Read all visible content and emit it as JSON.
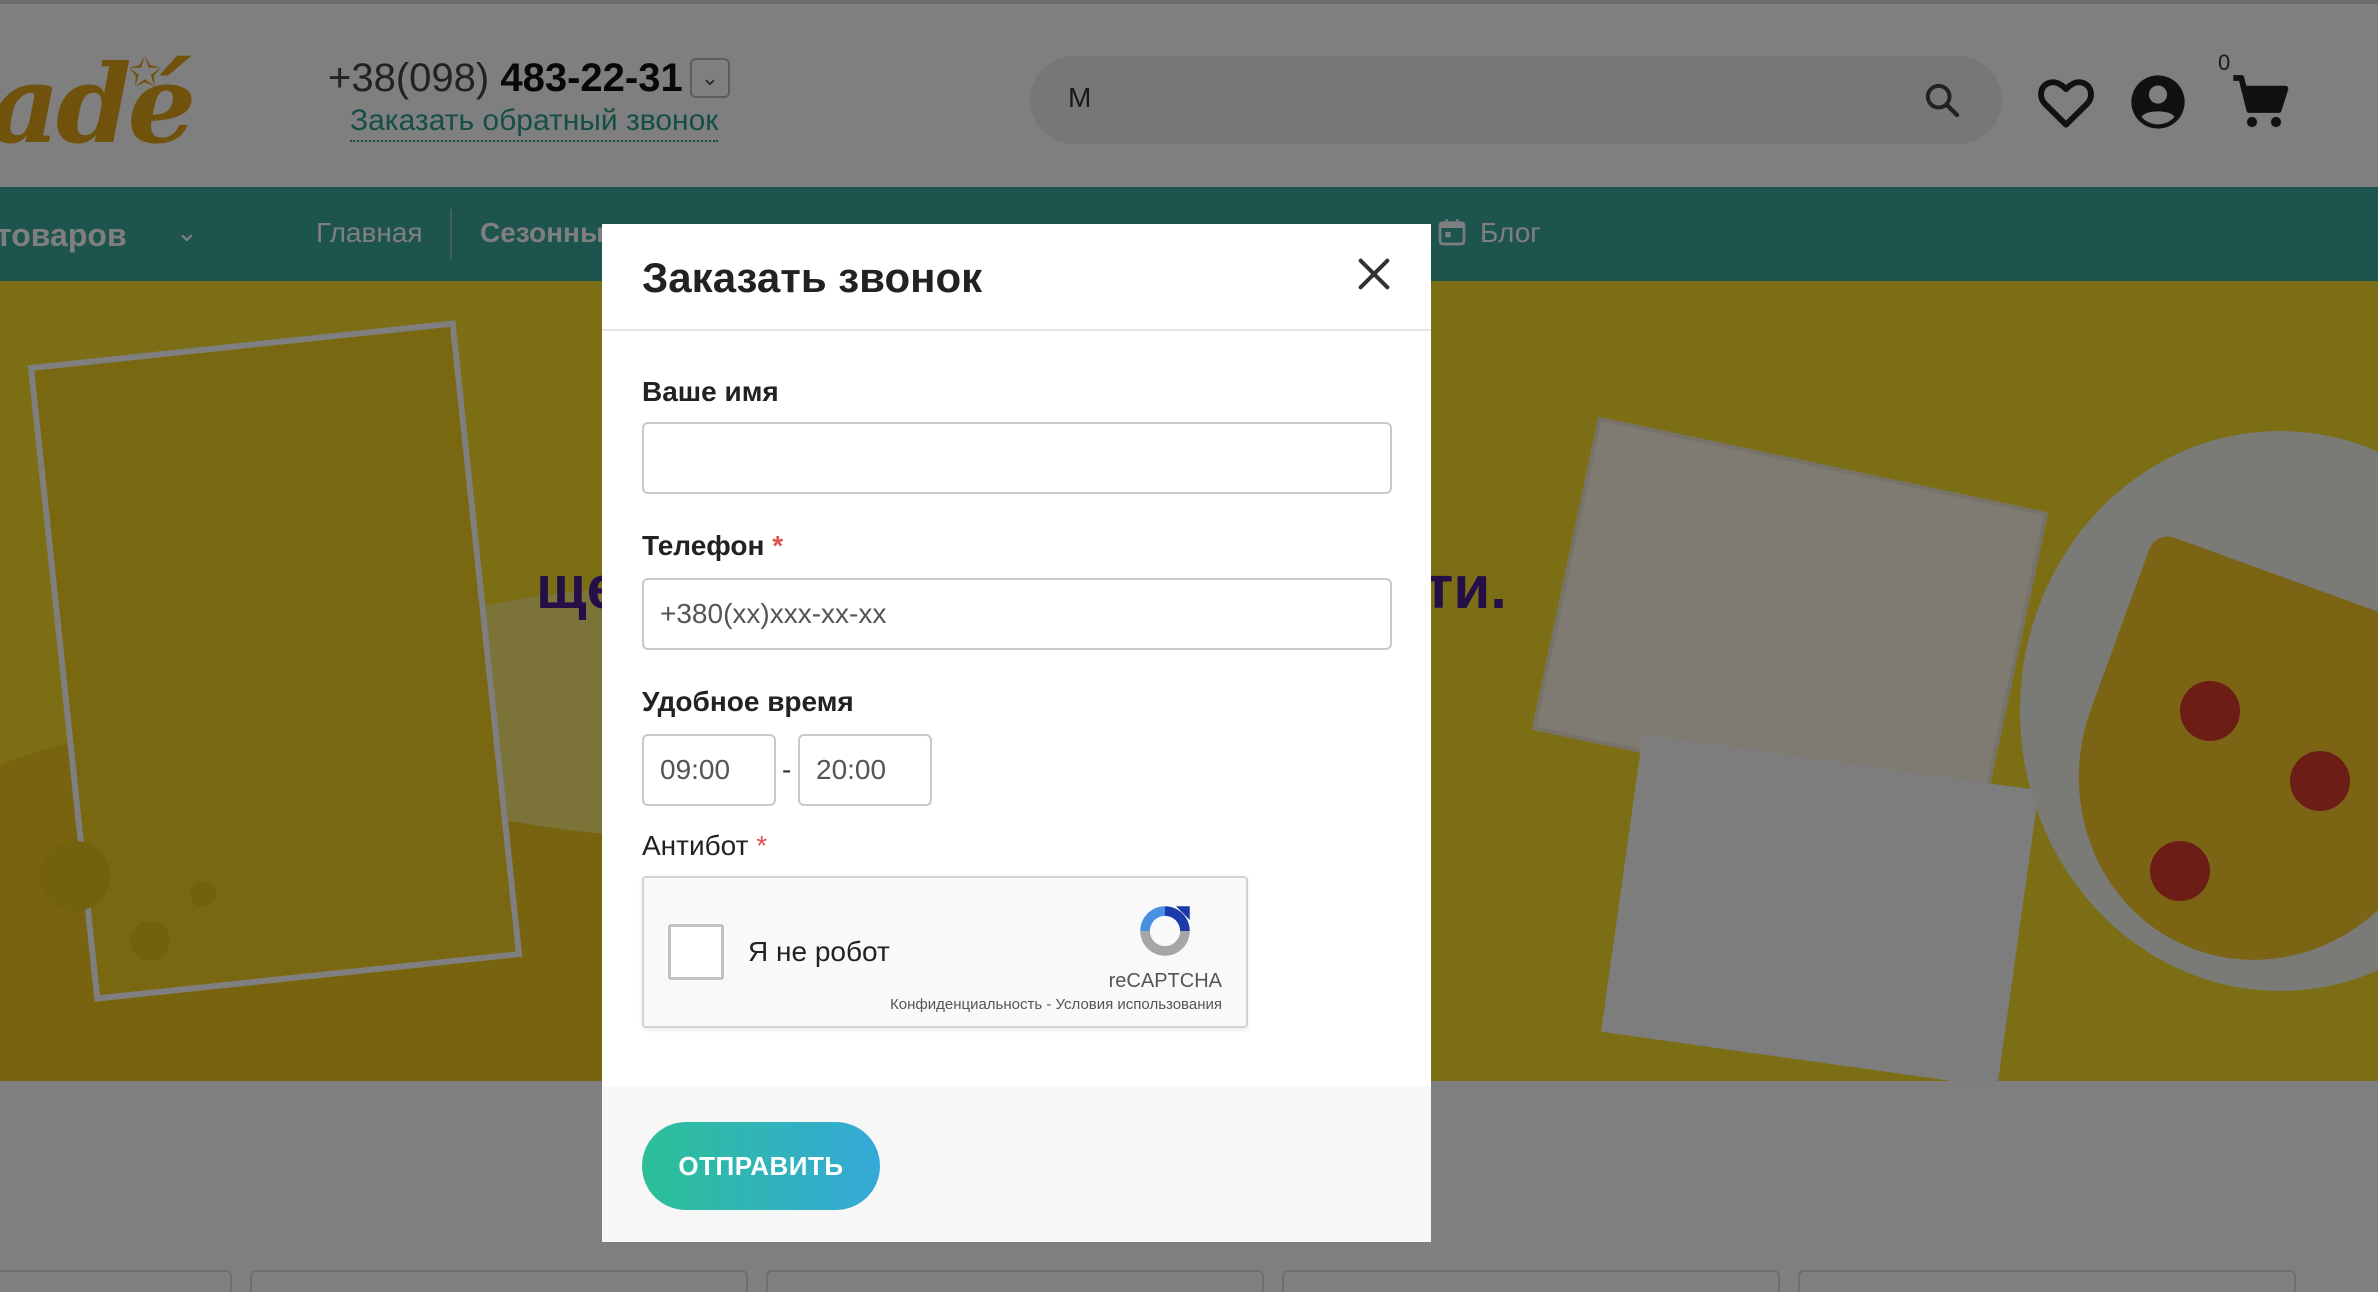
{
  "header": {
    "logo_text": "adé",
    "phone_prefix": "+38(098) ",
    "phone_number": "483-22-31",
    "callback_link": "Заказать обратный звонок",
    "search": {
      "value": "M"
    },
    "cart_count": "0"
  },
  "nav": {
    "catalog_label": "товаров",
    "items": [
      {
        "label": "Главная"
      },
      {
        "label": "Сезонны"
      },
      {
        "label": "Блог"
      }
    ]
  },
  "banner": {
    "text_left": "ще",
    "text_right": "ти."
  },
  "modal": {
    "title": "Заказать звонок",
    "fields": {
      "name": {
        "label": "Ваше имя",
        "value": ""
      },
      "phone": {
        "label": "Телефон",
        "required_mark": "*",
        "placeholder": "+380(xx)xxx-xx-xx"
      },
      "time": {
        "label": "Удобное время",
        "from_placeholder": "09:00",
        "to_placeholder": "20:00",
        "separator": "-"
      },
      "antibot": {
        "label": "Антибот",
        "required_mark": "*"
      }
    },
    "captcha": {
      "checkbox_label": "Я не робот",
      "brand": "reCAPTCHA",
      "links": "Конфиденциальность - Условия использования"
    },
    "submit_label": "ОТПРАВИТЬ"
  },
  "colors": {
    "nav_bg": "#3aa89d",
    "banner_bg": "#f6dc2b",
    "accent_gradient_start": "#2bbf97",
    "accent_gradient_end": "#35a9d8",
    "required": "#e05050"
  }
}
